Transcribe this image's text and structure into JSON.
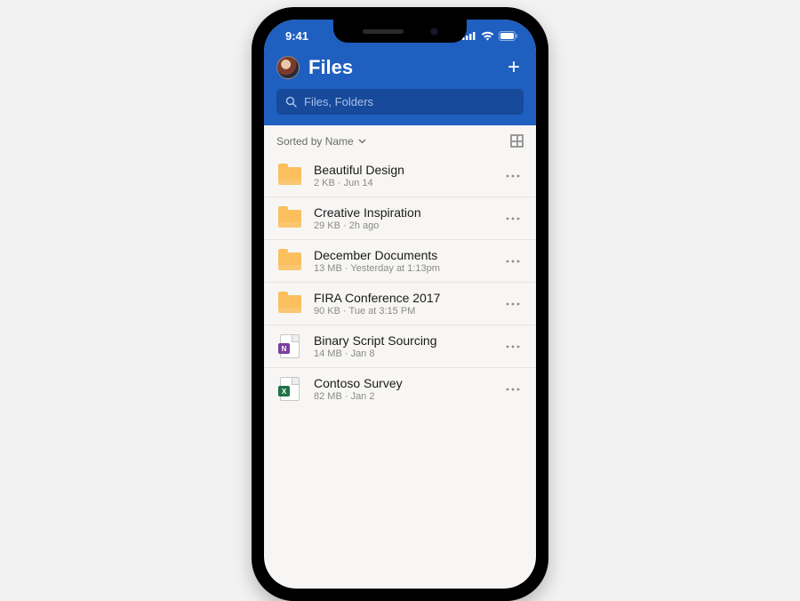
{
  "statusbar": {
    "time": "9:41"
  },
  "header": {
    "title": "Files",
    "add_label": "+"
  },
  "search": {
    "placeholder": "Files, Folders"
  },
  "sort": {
    "label": "Sorted by Name"
  },
  "items": [
    {
      "kind": "folder",
      "name": "Beautiful Design",
      "meta": "2 KB · Jun 14"
    },
    {
      "kind": "folder",
      "name": "Creative Inspiration",
      "meta": "29 KB · 2h ago"
    },
    {
      "kind": "folder",
      "name": "December Documents",
      "meta": "13 MB · Yesterday at 1:13pm"
    },
    {
      "kind": "folder",
      "name": "FIRA Conference 2017",
      "meta": "90 KB · Tue at 3:15 PM"
    },
    {
      "kind": "onenote",
      "name": "Binary Script Sourcing",
      "meta": "14 MB · Jan 8"
    },
    {
      "kind": "excel",
      "name": "Contoso Survey",
      "meta": "82 MB · Jan 2"
    }
  ],
  "icon_tags": {
    "onenote": "N",
    "excel": "X"
  },
  "colors": {
    "onenote": "#7b3fa0",
    "excel": "#1f7246"
  }
}
